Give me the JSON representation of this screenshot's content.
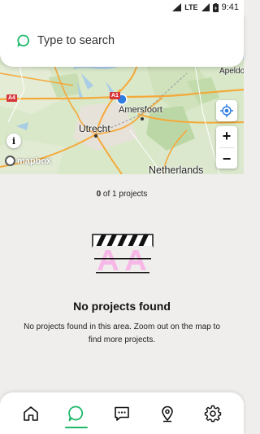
{
  "status_bar": {
    "network": "LTE",
    "time": "9:41"
  },
  "search": {
    "placeholder": "Type to search",
    "icon": "chat-bubble-search-icon"
  },
  "map": {
    "cities": [
      "Apeldo",
      "Amersfoort",
      "Utrecht"
    ],
    "country": "Netherlands",
    "roads": [
      "A4",
      "A1"
    ],
    "attribution": "mapbox",
    "zoom_in_label": "+",
    "zoom_out_label": "−",
    "info_label": "i"
  },
  "results": {
    "shown": "0",
    "of_text": "of",
    "total": "1",
    "noun": "projects"
  },
  "empty_state": {
    "title": "No projects found",
    "message": "No projects found in this area. Zoom out on the map to find more projects."
  },
  "nav": {
    "items": [
      {
        "name": "home-icon",
        "active": false
      },
      {
        "name": "search-chat-icon",
        "active": true
      },
      {
        "name": "messages-icon",
        "active": false
      },
      {
        "name": "location-pin-icon",
        "active": false
      },
      {
        "name": "settings-gear-icon",
        "active": false
      }
    ]
  },
  "colors": {
    "accent": "#1fb86a",
    "background": "#efeeec",
    "map_pin": "#2f7de1",
    "illustration_pink": "#f6b8e6"
  }
}
